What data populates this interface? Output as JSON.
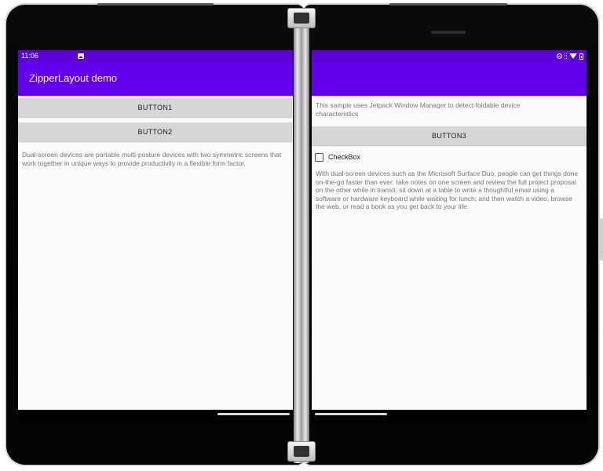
{
  "device": {
    "hinge_icon": "hinge-icon",
    "colors": {
      "status_bar": "#5b00d8",
      "app_bar": "#6200ee",
      "screen_bg": "#fafafa",
      "button_bg": "#d6d6d6",
      "body_text": "#757575"
    }
  },
  "left_screen": {
    "status_bar": {
      "time": "11:06",
      "icons": [
        "photo-icon"
      ]
    },
    "app_bar": {
      "title": "ZipperLayout demo"
    },
    "button1_label": "BUTTON1",
    "button2_label": "BUTTON2",
    "description": "Dual-screen devices are portable multi-posture devices with two symmetric screens that work together in unique ways to provide productivity in a flexible form factor."
  },
  "right_screen": {
    "status_bar": {
      "icons": [
        "do-not-disturb-icon",
        "vibrate-icon",
        "wifi-icon",
        "battery-icon"
      ]
    },
    "intro": "This sample uses Jetpack Window Manager to detect foldable device characteristics",
    "button3_label": "BUTTON3",
    "checkbox_label": "CheckBox",
    "checkbox_checked": false,
    "description": "With dual-screen devices such as the Microsoft Surface Duo, people can get things done on-the-go faster than ever: take notes on one screen and review the full project proposal on the other while in transit; sit down at a table to write a thoughtful email using a software or hardware keyboard while waiting for lunch; and then watch a video, browse the web, or read a book as you get back to your life."
  }
}
